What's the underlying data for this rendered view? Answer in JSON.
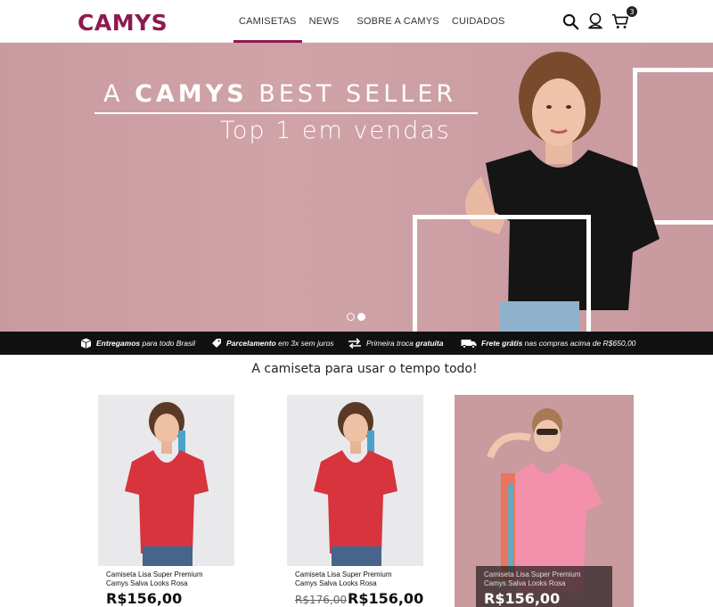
{
  "brand": {
    "logo": "CAMYS",
    "accent": "#8d1a4f"
  },
  "nav": {
    "items": [
      {
        "label": "CAMISETAS",
        "active": true
      },
      {
        "label": "NEWS",
        "active": false
      },
      {
        "label": "SOBRE A CAMYS",
        "active": false
      },
      {
        "label": "CUIDADOS",
        "active": false
      }
    ]
  },
  "header_icons": {
    "search": "search-icon",
    "account": "user-icon",
    "cart": "cart-icon",
    "cart_count": "3"
  },
  "hero": {
    "title_prefix": "A",
    "title_bold": "CAMYS",
    "title_suffix": "BEST SELLER",
    "subtitle": "Top  1 em vendas",
    "slide_count": 2,
    "active_slide": 2,
    "background": "#cba0a4"
  },
  "benefits": [
    {
      "icon": "box-icon",
      "bold": "Entregamos",
      "text": " para todo Brasil"
    },
    {
      "icon": "tag-icon",
      "bold": "Parcelamento",
      "text": " em 3x sem juros"
    },
    {
      "icon": "exchange-icon",
      "pre": "Primeira troca ",
      "bold": "gratuita"
    },
    {
      "icon": "truck-icon",
      "bold": "Frete grátis",
      "text": " nas compras acima de R$650,00"
    }
  ],
  "section": {
    "title": "A camiseta para usar o tempo todo!"
  },
  "products": [
    {
      "name_line1": "Camiseta Lisa Super Premium",
      "name_line2": "Camys Salva Looks Rosa",
      "old_price": "",
      "price": "R$156,00",
      "shirt_color": "#d7343d"
    },
    {
      "name_line1": "Camiseta Lisa Super Premium",
      "name_line2": "Camys Salva Looks Rosa",
      "old_price": "R$176,00",
      "price": "R$156,00",
      "shirt_color": "#d7343d"
    },
    {
      "name_line1": "Camiseta Lisa Super Premium",
      "name_line2": "Camys Salva Looks Rosa",
      "old_price": "",
      "price": "R$156,00",
      "shirt_color": "#f08aa6"
    }
  ]
}
